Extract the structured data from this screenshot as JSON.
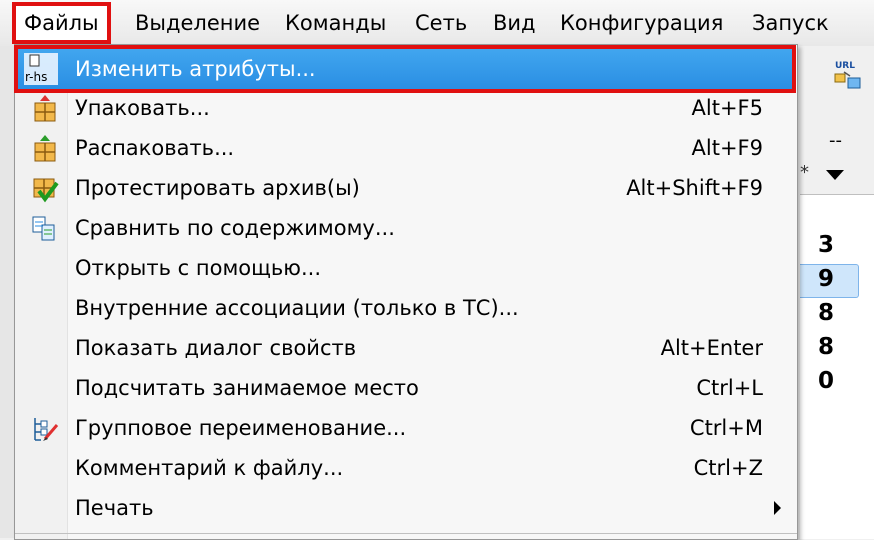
{
  "menubar": {
    "items": [
      {
        "label": "Файлы"
      },
      {
        "label": "Выделение"
      },
      {
        "label": "Команды"
      },
      {
        "label": "Сеть"
      },
      {
        "label": "Вид"
      },
      {
        "label": "Конфигурация"
      },
      {
        "label": "Запуск"
      }
    ]
  },
  "background": {
    "dashes": "--",
    "star": "*",
    "digits": [
      "3",
      "9",
      "8",
      "8",
      "0"
    ],
    "toolbar_icon_text": "URL"
  },
  "file_menu": {
    "items": [
      {
        "label": "Изменить атрибуты...",
        "shortcut": "",
        "icon": "attributes-icon",
        "icon_text": "r-hs"
      },
      {
        "label": "Упаковать...",
        "shortcut": "Alt+F5",
        "icon": "pack-icon"
      },
      {
        "label": "Распаковать...",
        "shortcut": "Alt+F9",
        "icon": "unpack-icon"
      },
      {
        "label": "Протестировать архив(ы)",
        "shortcut": "Alt+Shift+F9",
        "icon": "test-archive-icon"
      },
      {
        "label": "Сравнить по содержимому...",
        "shortcut": "",
        "icon": "compare-icon"
      },
      {
        "label": "Открыть с помощью...",
        "shortcut": ""
      },
      {
        "label": "Внутренние ассоциации (только в ТС)...",
        "shortcut": ""
      },
      {
        "label": "Показать диалог свойств",
        "shortcut": "Alt+Enter"
      },
      {
        "label": "Подсчитать занимаемое место",
        "shortcut": "Ctrl+L"
      },
      {
        "label": "Групповое переименование...",
        "shortcut": "Ctrl+M",
        "icon": "multi-rename-icon"
      },
      {
        "label": "Комментарий к файлу...",
        "shortcut": "Ctrl+Z"
      },
      {
        "label": "Печать",
        "shortcut": "",
        "submenu": true
      }
    ]
  },
  "colors": {
    "highlight": "#2f95e6",
    "annotation_red": "#e01010"
  }
}
